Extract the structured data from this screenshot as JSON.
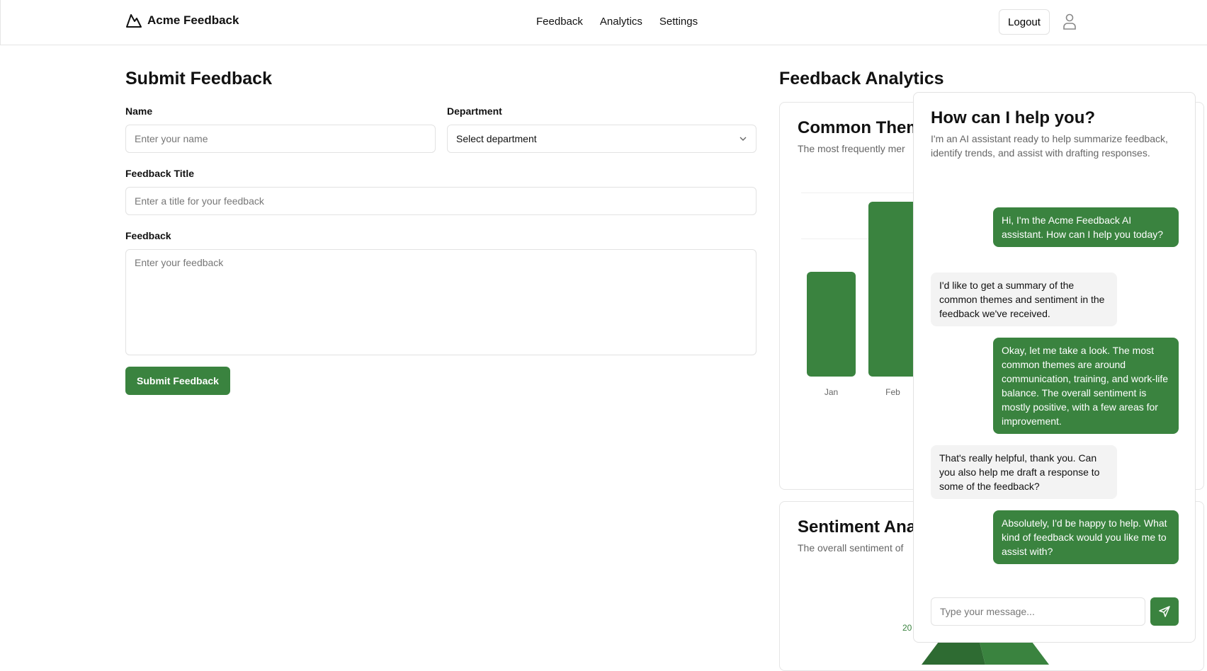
{
  "header": {
    "brand": "Acme Feedback",
    "nav": [
      "Feedback",
      "Analytics",
      "Settings"
    ],
    "logout": "Logout"
  },
  "form": {
    "title": "Submit Feedback",
    "name_label": "Name",
    "name_placeholder": "Enter your name",
    "dept_label": "Department",
    "dept_value": "Select department",
    "ftitle_label": "Feedback Title",
    "ftitle_placeholder": "Enter a title for your feedback",
    "feedback_label": "Feedback",
    "feedback_placeholder": "Enter your feedback",
    "submit": "Submit Feedback"
  },
  "analytics": {
    "title": "Feedback Analytics",
    "themes_title": "Common Them",
    "themes_sub": "The most frequently mer",
    "sentiment_title": "Sentiment Ana",
    "sentiment_sub": "The overall sentiment of",
    "pie_label": "20"
  },
  "chart_data": {
    "type": "bar",
    "categories": [
      "Jan",
      "Feb"
    ],
    "values": [
      150,
      250
    ],
    "color": "#3a833f"
  },
  "chat": {
    "title": "How can I help you?",
    "subtitle": "I'm an AI assistant ready to help summarize feedback, identify trends, and assist with drafting responses.",
    "messages": [
      {
        "role": "assistant",
        "text": "Hi, I'm the Acme Feedback AI assistant. How can I help you today?"
      },
      {
        "role": "user",
        "text": "I'd like to get a summary of the common themes and sentiment in the feedback we've received."
      },
      {
        "role": "assistant",
        "text": "Okay, let me take a look. The most common themes are around communication, training, and work-life balance. The overall sentiment is mostly positive, with a few areas for improvement."
      },
      {
        "role": "user",
        "text": "That's really helpful, thank you. Can you also help me draft a response to some of the feedback?"
      },
      {
        "role": "assistant",
        "text": "Absolutely, I'd be happy to help. What kind of feedback would you like me to assist with?"
      }
    ],
    "input_placeholder": "Type your message..."
  },
  "colors": {
    "accent": "#3a833f"
  }
}
